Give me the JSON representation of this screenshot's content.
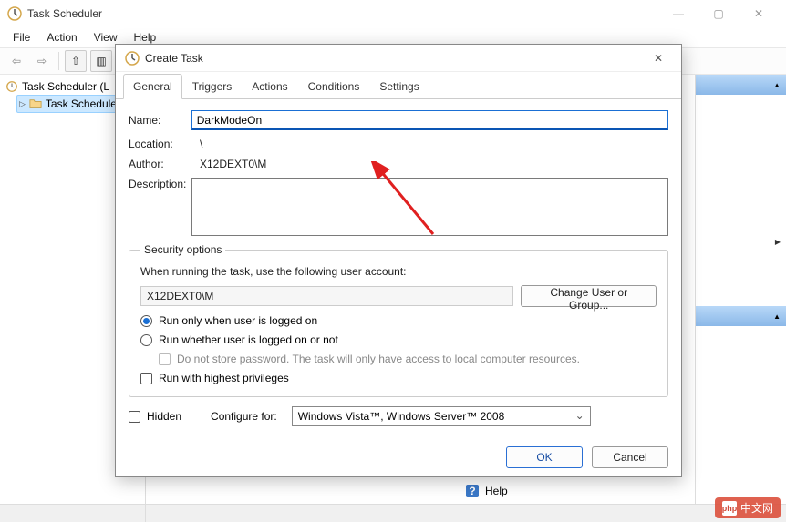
{
  "app": {
    "title": "Task Scheduler",
    "menus": [
      "File",
      "Action",
      "View",
      "Help"
    ]
  },
  "tree": {
    "root": "Task Scheduler (L",
    "child": "Task Schedule"
  },
  "bottom_help": "Help",
  "dialog": {
    "title": "Create Task",
    "tabs": [
      "General",
      "Triggers",
      "Actions",
      "Conditions",
      "Settings"
    ],
    "name_label": "Name:",
    "name_value": "DarkModeOn",
    "location_label": "Location:",
    "location_value": "\\",
    "author_label": "Author:",
    "author_value": "X12DEXT0\\M",
    "description_label": "Description:",
    "security": {
      "legend": "Security options",
      "run_as_label": "When running the task, use the following user account:",
      "account": "X12DEXT0\\M",
      "change_btn": "Change User or Group...",
      "opt_logged_on": "Run only when user is logged on",
      "opt_whether": "Run whether user is logged on or not",
      "opt_nostore": "Do not store password.  The task will only have access to local computer resources.",
      "opt_highest": "Run with highest privileges"
    },
    "hidden_label": "Hidden",
    "configure_label": "Configure for:",
    "configure_value": "Windows Vista™, Windows Server™ 2008",
    "ok": "OK",
    "cancel": "Cancel"
  },
  "watermark": "中文网"
}
